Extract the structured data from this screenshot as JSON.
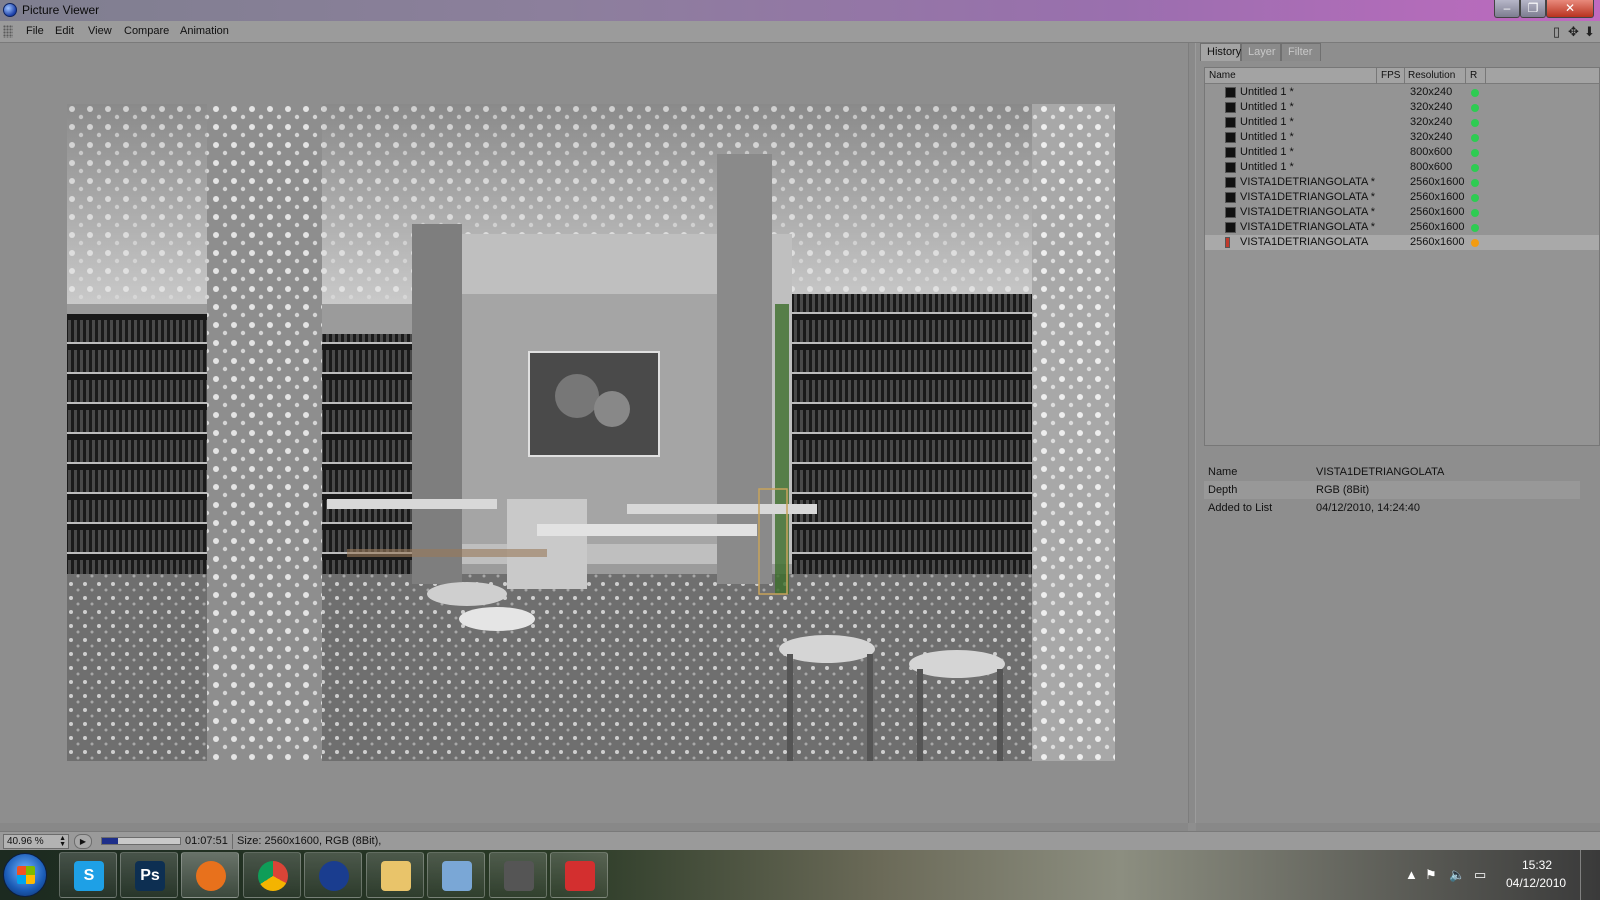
{
  "window": {
    "title": "Picture Viewer"
  },
  "menu": [
    "File",
    "Edit",
    "View",
    "Compare",
    "Animation"
  ],
  "tabs": [
    {
      "label": "History",
      "active": true
    },
    {
      "label": "Layer",
      "active": false
    },
    {
      "label": "Filter",
      "active": false
    }
  ],
  "list": {
    "columns": {
      "name": "Name",
      "fps": "FPS",
      "resolution": "Resolution",
      "r": "R"
    },
    "rows": [
      {
        "name": "Untitled 1 *",
        "resolution": "320x240",
        "status": "green"
      },
      {
        "name": "Untitled 1 *",
        "resolution": "320x240",
        "status": "green"
      },
      {
        "name": "Untitled 1 *",
        "resolution": "320x240",
        "status": "green"
      },
      {
        "name": "Untitled 1 *",
        "resolution": "320x240",
        "status": "green"
      },
      {
        "name": "Untitled 1 *",
        "resolution": "800x600",
        "status": "green"
      },
      {
        "name": "Untitled 1 *",
        "resolution": "800x600",
        "status": "green"
      },
      {
        "name": "VISTA1DETRIANGOLATA *",
        "resolution": "2560x1600",
        "status": "green"
      },
      {
        "name": "VISTA1DETRIANGOLATA *",
        "resolution": "2560x1600",
        "status": "green"
      },
      {
        "name": "VISTA1DETRIANGOLATA *",
        "resolution": "2560x1600",
        "status": "green"
      },
      {
        "name": "VISTA1DETRIANGOLATA *",
        "resolution": "2560x1600",
        "status": "green"
      },
      {
        "name": "VISTA1DETRIANGOLATA",
        "resolution": "2560x1600",
        "status": "orange",
        "selected": true
      }
    ]
  },
  "info": {
    "name_label": "Name",
    "name_value": "VISTA1DETRIANGOLATA",
    "depth_label": "Depth",
    "depth_value": "RGB (8Bit)",
    "added_label": "Added to List",
    "added_value": "04/12/2010, 14:24:40"
  },
  "status": {
    "zoom": "40.96 %",
    "progress": 0.2,
    "time": "01:07:51",
    "size": "Size: 2560x1600, RGB (8Bit),"
  },
  "colors": {
    "green": "#2ecc52",
    "orange": "#f39c12",
    "progress": "#1d2e8a"
  },
  "taskbar": {
    "apps": [
      {
        "icon": "skype-icon",
        "glyph": "S",
        "color": "#1ea0e6"
      },
      {
        "icon": "photoshop-icon",
        "glyph": "Ps",
        "color": "#0d2f52"
      },
      {
        "icon": "firefox-icon",
        "glyph": "",
        "color": "#e8711c"
      },
      {
        "icon": "chrome-icon",
        "glyph": "",
        "color": "#ffffff"
      },
      {
        "icon": "cinema4d-icon",
        "glyph": "",
        "color": "#1a3d8f"
      },
      {
        "icon": "folder-icon",
        "glyph": "",
        "color": "#e9c46a"
      },
      {
        "icon": "picture-viewer-icon",
        "glyph": "",
        "color": "#7aa7d6"
      },
      {
        "icon": "scanner-icon",
        "glyph": "",
        "color": "#555555"
      },
      {
        "icon": "pdf-icon",
        "glyph": "",
        "color": "#d32f2f"
      }
    ],
    "clock_time": "15:32",
    "clock_date": "04/12/2010"
  }
}
